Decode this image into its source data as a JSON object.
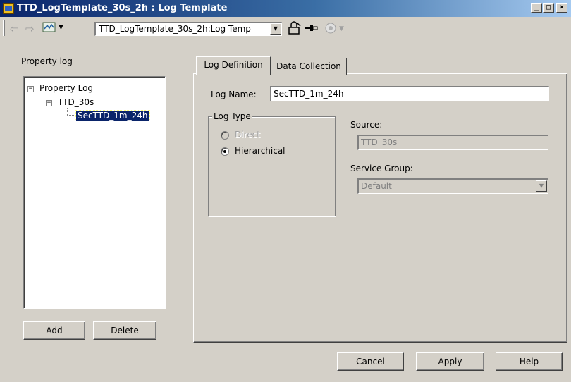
{
  "window": {
    "title": "TTD_LogTemplate_30s_2h : Log Template",
    "controls": {
      "minimize": "_",
      "maximize": "□",
      "close": "×"
    }
  },
  "toolbar": {
    "icons": [
      "back-arrow-icon",
      "forward-arrow-icon",
      "object-view-icon",
      "lock-icon",
      "pin-icon",
      "eye-icon"
    ],
    "object_combo_value": "TTD_LogTemplate_30s_2h:Log Temp"
  },
  "left_panel": {
    "title": "Property log",
    "tree": [
      {
        "label": "Property Log",
        "level": 0,
        "expanded": true
      },
      {
        "label": "TTD_30s",
        "level": 1,
        "expanded": true
      },
      {
        "label": "SecTTD_1m_24h",
        "level": 2,
        "selected": true
      }
    ],
    "add_label": "Add",
    "delete_label": "Delete"
  },
  "tabs": [
    {
      "label": "Log Definition",
      "active": true
    },
    {
      "label": "Data Collection",
      "active": false
    }
  ],
  "log_definition": {
    "log_name_label": "Log Name:",
    "log_name_value": "SecTTD_1m_24h",
    "log_type_label": "Log Type",
    "options": [
      {
        "label": "Direct",
        "checked": false,
        "enabled": false
      },
      {
        "label": "Hierarchical",
        "checked": true,
        "enabled": true
      }
    ],
    "source_label": "Source:",
    "source_value": "TTD_30s",
    "service_group_label": "Service Group:",
    "service_group_value": "Default"
  },
  "footer": {
    "cancel_label": "Cancel",
    "apply_label": "Apply",
    "help_label": "Help"
  },
  "colors": {
    "titlebar_start": "#0a246a",
    "titlebar_end": "#a6caf0",
    "face": "#d4d0c8",
    "selection": "#0a246a"
  }
}
